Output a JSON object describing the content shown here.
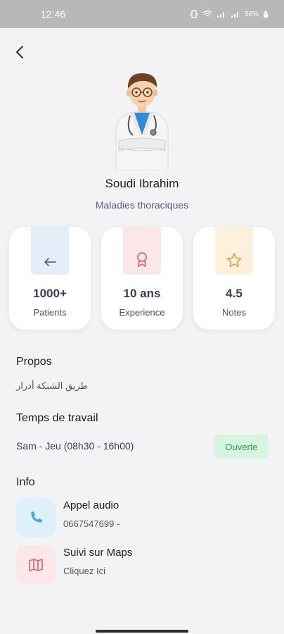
{
  "status_bar": {
    "time": "12:46",
    "battery": "56%"
  },
  "doctor": {
    "name": "Soudi Ibrahim",
    "specialty": "Maladies thoraciques"
  },
  "stats": [
    {
      "value": "1000+",
      "label": "Patients",
      "icon": "arrow-left-icon",
      "color": "#e3eef8"
    },
    {
      "value": "10 ans",
      "label": "Experience",
      "icon": "award-icon",
      "color": "#fbe6ea"
    },
    {
      "value": "4.5",
      "label": "Notes",
      "icon": "star-icon",
      "color": "#fdf0dd"
    }
  ],
  "about": {
    "title": "Propos",
    "text": "طريق الشبكة أدرار"
  },
  "work_time": {
    "title": "Temps de travail",
    "hours": "Sam - Jeu (08h30 - 16h00)",
    "status": "Ouverte"
  },
  "info": {
    "title": "Info",
    "items": [
      {
        "title": "Appel audio",
        "subtitle": "0667547699   -",
        "icon": "phone-icon",
        "color": "#def0fa"
      },
      {
        "title": "Suivi sur Maps",
        "subtitle": "Cliquez Ici",
        "icon": "map-icon",
        "color": "#fbe6ea"
      }
    ]
  }
}
